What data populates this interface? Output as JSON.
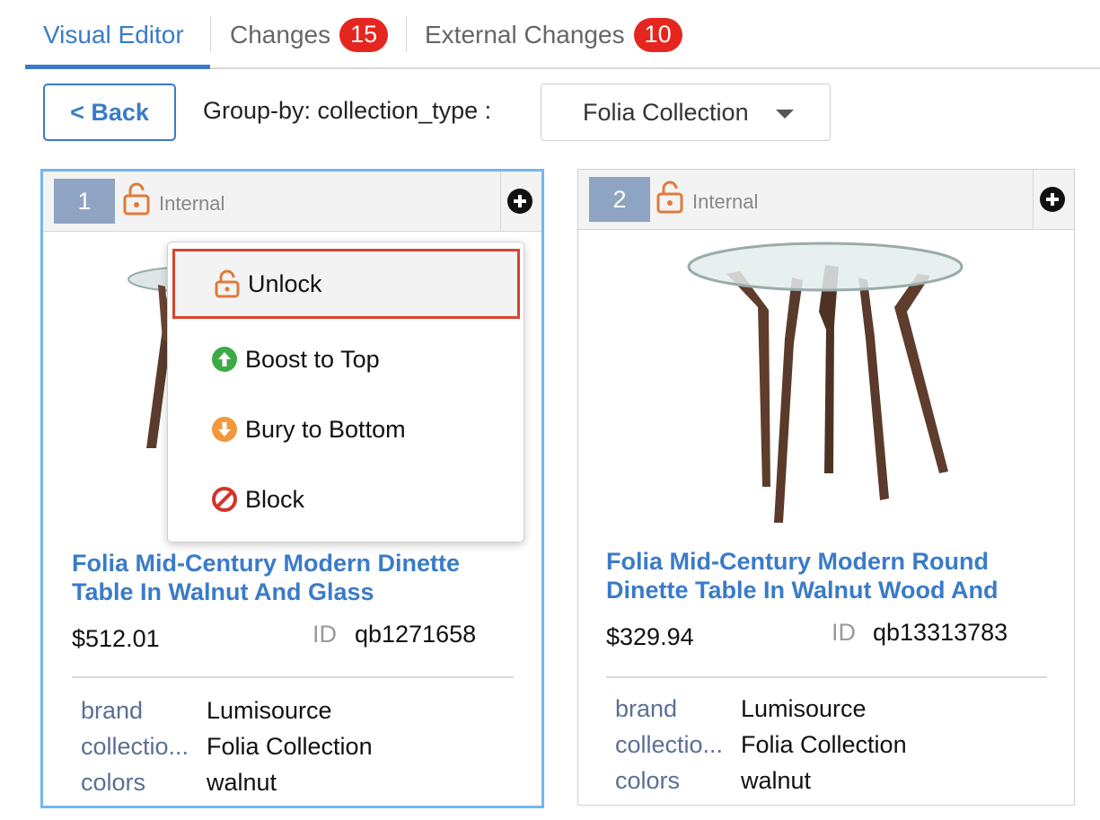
{
  "tabs": [
    {
      "label": "Visual Editor",
      "badge": ""
    },
    {
      "label": "Changes",
      "badge": "15"
    },
    {
      "label": "External Changes",
      "badge": "10"
    }
  ],
  "toolbar": {
    "back_label": "< Back",
    "groupby_label": "Group-by: collection_type :",
    "groupby_value": "Folia Collection"
  },
  "menu": {
    "items": [
      {
        "label": "Unlock",
        "icon": "unlock-icon"
      },
      {
        "label": "Boost to Top",
        "icon": "arrow-up-circle-icon"
      },
      {
        "label": "Bury to Bottom",
        "icon": "arrow-down-circle-icon"
      },
      {
        "label": "Block",
        "icon": "block-icon"
      }
    ]
  },
  "products": [
    {
      "rank": "1",
      "visibility": "Internal",
      "title": "Folia Mid-Century Modern Dinette Table In Walnut And Glass",
      "price": "$512.01",
      "id_label": "ID",
      "id": "qb1271658",
      "attrs": [
        {
          "key": "brand",
          "value": "Lumisource"
        },
        {
          "key": "collectio...",
          "value": "Folia Collection"
        },
        {
          "key": "colors",
          "value": "walnut"
        }
      ]
    },
    {
      "rank": "2",
      "visibility": "Internal",
      "title": "Folia Mid-Century Modern Round Dinette Table In Walnut Wood And",
      "price": "$329.94",
      "id_label": "ID",
      "id": "qb13313783",
      "attrs": [
        {
          "key": "brand",
          "value": "Lumisource"
        },
        {
          "key": "collectio...",
          "value": "Folia Collection"
        },
        {
          "key": "colors",
          "value": "walnut"
        }
      ]
    }
  ],
  "colors": {
    "accent": "#3a7bc8",
    "badge": "#e5261f",
    "lock": "#e07a3a",
    "boost": "#3daa47",
    "bury": "#f0993c",
    "block": "#d4332a",
    "highlight_border": "#d9432f"
  }
}
